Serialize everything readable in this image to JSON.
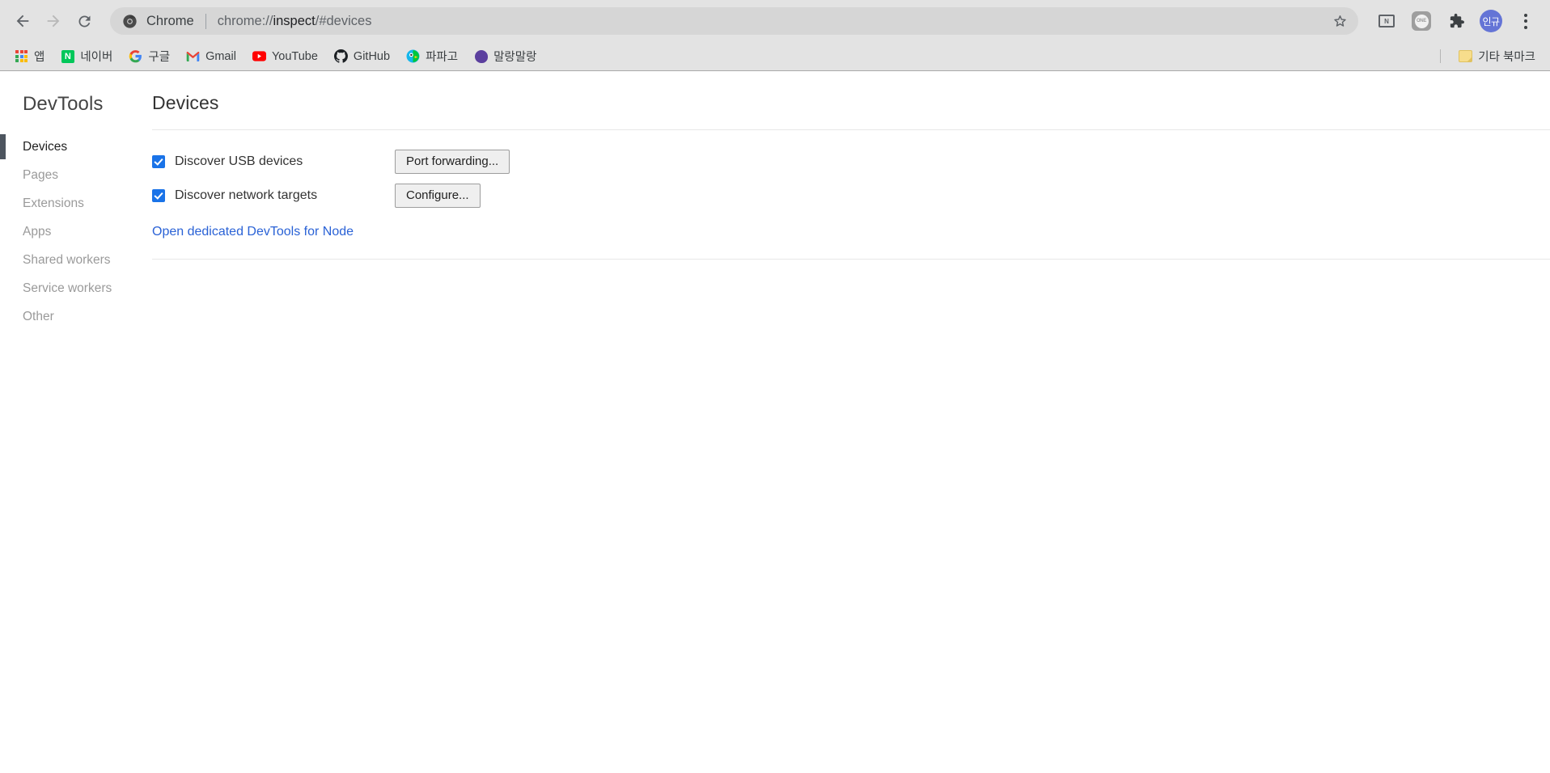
{
  "browser": {
    "nav": {
      "back_label": "Back",
      "forward_label": "Forward",
      "reload_label": "Reload"
    },
    "omnibox": {
      "app_label": "Chrome",
      "url_prefix": "chrome://",
      "url_bold": "inspect",
      "url_suffix": "/#devices",
      "full_url": "chrome://inspect/#devices",
      "bookmark_star_label": "Bookmark this tab"
    },
    "toolbar_icons": [
      {
        "name": "cast-icon",
        "glyph": "N"
      },
      {
        "name": "one-extension-icon",
        "glyph": "ONE"
      },
      {
        "name": "extensions-puzzle-icon",
        "glyph": ""
      },
      {
        "name": "profile-avatar",
        "glyph": "인규"
      },
      {
        "name": "chrome-menu-icon",
        "glyph": ""
      }
    ],
    "bookmarks": [
      {
        "label": "앱",
        "icon": "apps-grid-icon"
      },
      {
        "label": "네이버",
        "icon": "naver-icon"
      },
      {
        "label": "구글",
        "icon": "google-icon"
      },
      {
        "label": "Gmail",
        "icon": "gmail-icon"
      },
      {
        "label": "YouTube",
        "icon": "youtube-icon"
      },
      {
        "label": "GitHub",
        "icon": "github-icon"
      },
      {
        "label": "파파고",
        "icon": "papago-icon"
      },
      {
        "label": "말랑말랑",
        "icon": "mallang-icon"
      }
    ],
    "other_bookmarks": {
      "label": "기타 북마크",
      "icon": "folder-icon"
    }
  },
  "devtools": {
    "sidebar": {
      "title": "DevTools",
      "items": [
        {
          "label": "Devices",
          "active": true
        },
        {
          "label": "Pages",
          "active": false
        },
        {
          "label": "Extensions",
          "active": false
        },
        {
          "label": "Apps",
          "active": false
        },
        {
          "label": "Shared workers",
          "active": false
        },
        {
          "label": "Service workers",
          "active": false
        },
        {
          "label": "Other",
          "active": false
        }
      ]
    },
    "main": {
      "title": "Devices",
      "options": [
        {
          "label": "Discover USB devices",
          "checked": true,
          "button": "Port forwarding..."
        },
        {
          "label": "Discover network targets",
          "checked": true,
          "button": "Configure..."
        }
      ],
      "node_link": "Open dedicated DevTools for Node"
    }
  },
  "colors": {
    "chrome_bg": "#e3e3e3",
    "omnibox_bg": "#d6d6d6",
    "accent_blue": "#1a73e8",
    "link_blue": "#2a62d6",
    "active_bar": "#4d555f",
    "naver_green": "#03c75a"
  }
}
